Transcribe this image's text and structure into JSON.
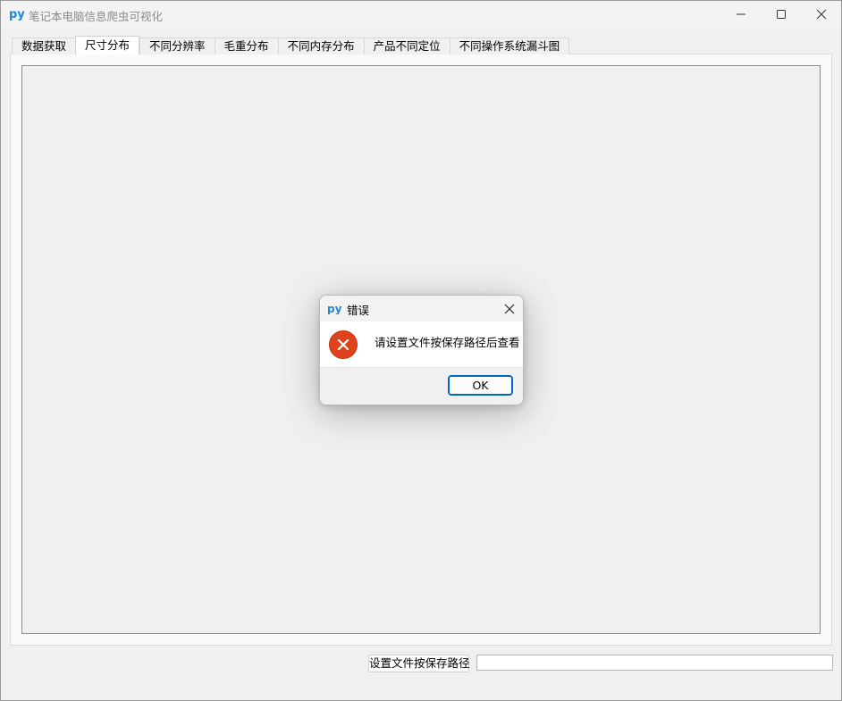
{
  "window": {
    "title": "笔记本电脑信息爬虫可视化",
    "app_icon": "python-py-icon"
  },
  "tabs": [
    {
      "label": "数据获取",
      "active": false
    },
    {
      "label": "尺寸分布",
      "active": true
    },
    {
      "label": "不同分辨率",
      "active": false
    },
    {
      "label": "毛重分布",
      "active": false
    },
    {
      "label": "不同内存分布",
      "active": false
    },
    {
      "label": "产品不同定位",
      "active": false
    },
    {
      "label": "不同操作系统漏斗图",
      "active": false
    }
  ],
  "footer": {
    "path_button_label": "设置文件按保存路径",
    "path_input_value": ""
  },
  "dialog": {
    "title": "错误",
    "message": "请设置文件按保存路径后查看",
    "ok_label": "OK",
    "error_color": "#e0431c",
    "accent_color": "#0067c0"
  }
}
